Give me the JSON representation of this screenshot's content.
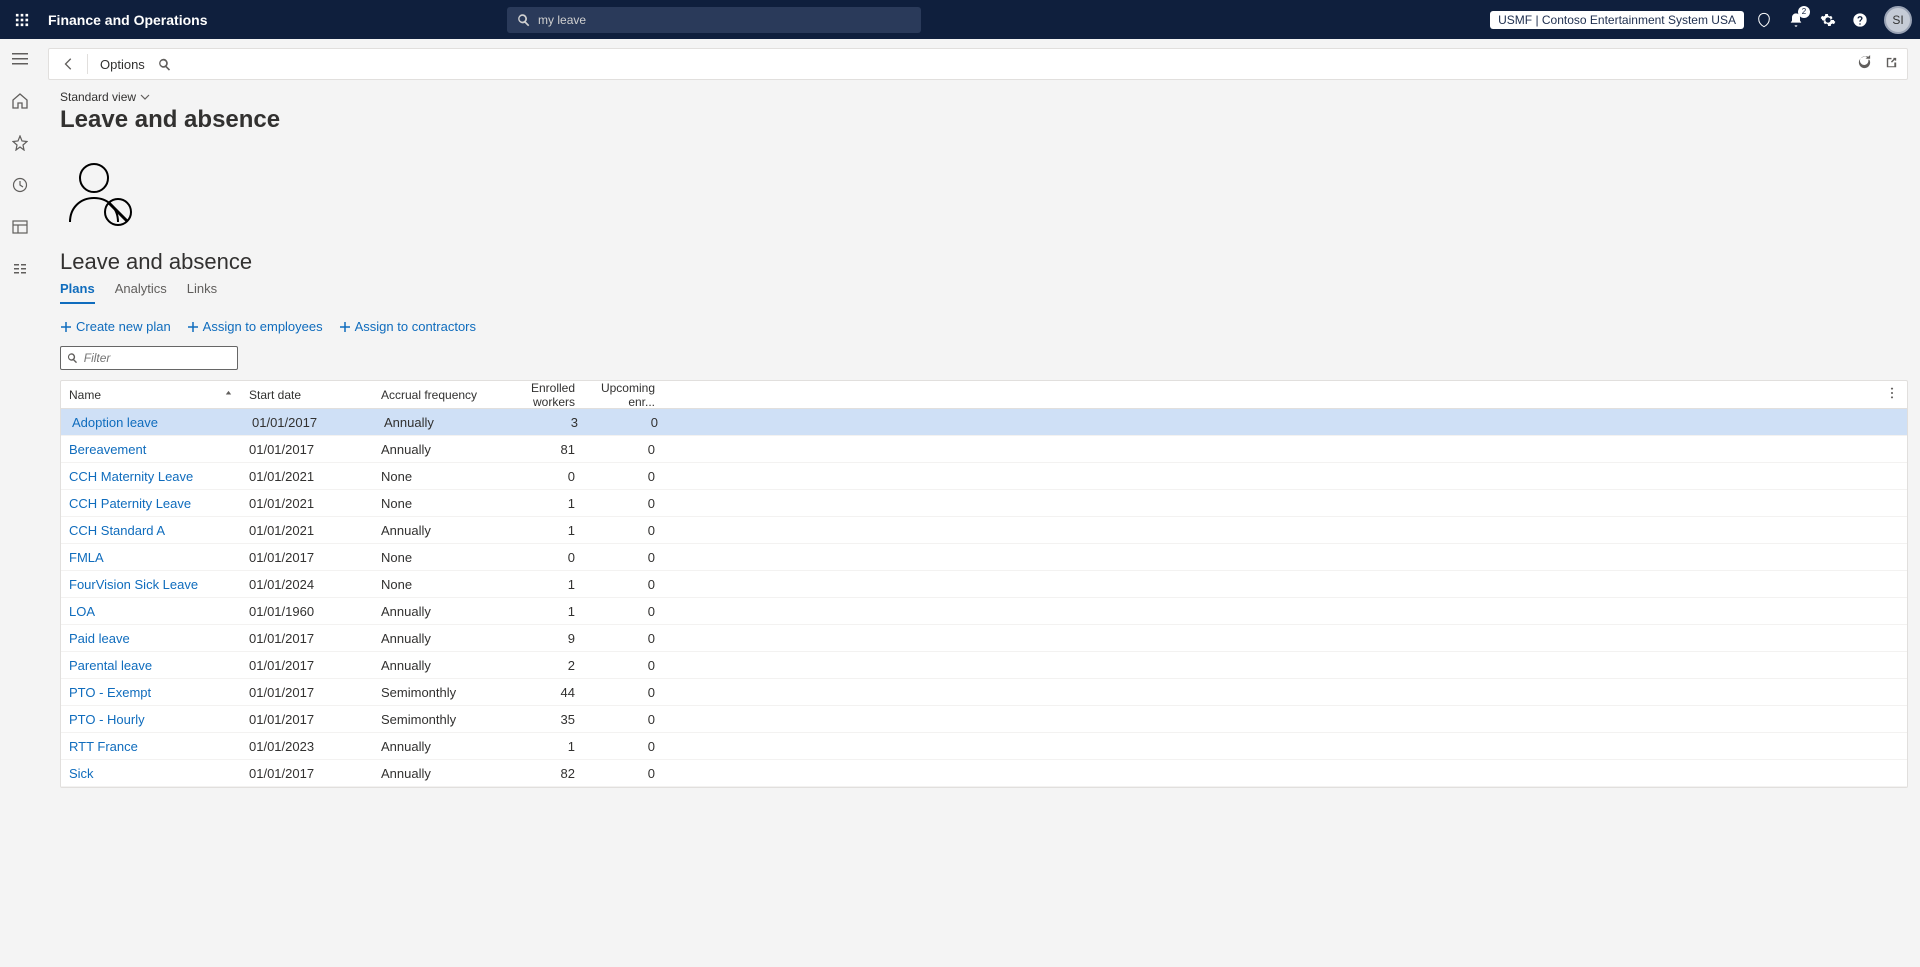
{
  "header": {
    "app_title": "Finance and Operations",
    "search_value": "my leave",
    "company": "USMF | Contoso Entertainment System USA",
    "notif_count": "2",
    "avatar": "SI"
  },
  "toolbar": {
    "options_label": "Options"
  },
  "page": {
    "view_selector": "Standard view",
    "title": "Leave and absence",
    "section_title": "Leave and absence"
  },
  "tabs": [
    {
      "label": "Plans",
      "active": true
    },
    {
      "label": "Analytics",
      "active": false
    },
    {
      "label": "Links",
      "active": false
    }
  ],
  "actions": [
    {
      "label": "Create new plan"
    },
    {
      "label": "Assign to employees"
    },
    {
      "label": "Assign to contractors"
    }
  ],
  "filter": {
    "placeholder": "Filter"
  },
  "columns": {
    "name": "Name",
    "start": "Start date",
    "acc": "Accrual frequency",
    "enr": "Enrolled workers",
    "upc": "Upcoming enr..."
  },
  "rows": [
    {
      "name": "Adoption leave",
      "start": "01/01/2017",
      "acc": "Annually",
      "enr": "3",
      "upc": "0",
      "selected": true
    },
    {
      "name": "Bereavement",
      "start": "01/01/2017",
      "acc": "Annually",
      "enr": "81",
      "upc": "0"
    },
    {
      "name": "CCH Maternity Leave",
      "start": "01/01/2021",
      "acc": "None",
      "enr": "0",
      "upc": "0"
    },
    {
      "name": "CCH Paternity Leave",
      "start": "01/01/2021",
      "acc": "None",
      "enr": "1",
      "upc": "0"
    },
    {
      "name": "CCH Standard A",
      "start": "01/01/2021",
      "acc": "Annually",
      "enr": "1",
      "upc": "0"
    },
    {
      "name": "FMLA",
      "start": "01/01/2017",
      "acc": "None",
      "enr": "0",
      "upc": "0"
    },
    {
      "name": "FourVision Sick Leave",
      "start": "01/01/2024",
      "acc": "None",
      "enr": "1",
      "upc": "0"
    },
    {
      "name": "LOA",
      "start": "01/01/1960",
      "acc": "Annually",
      "enr": "1",
      "upc": "0"
    },
    {
      "name": "Paid leave",
      "start": "01/01/2017",
      "acc": "Annually",
      "enr": "9",
      "upc": "0"
    },
    {
      "name": "Parental leave",
      "start": "01/01/2017",
      "acc": "Annually",
      "enr": "2",
      "upc": "0"
    },
    {
      "name": "PTO - Exempt",
      "start": "01/01/2017",
      "acc": "Semimonthly",
      "enr": "44",
      "upc": "0"
    },
    {
      "name": "PTO - Hourly",
      "start": "01/01/2017",
      "acc": "Semimonthly",
      "enr": "35",
      "upc": "0"
    },
    {
      "name": "RTT France",
      "start": "01/01/2023",
      "acc": "Annually",
      "enr": "1",
      "upc": "0"
    },
    {
      "name": "Sick",
      "start": "01/01/2017",
      "acc": "Annually",
      "enr": "82",
      "upc": "0"
    }
  ]
}
